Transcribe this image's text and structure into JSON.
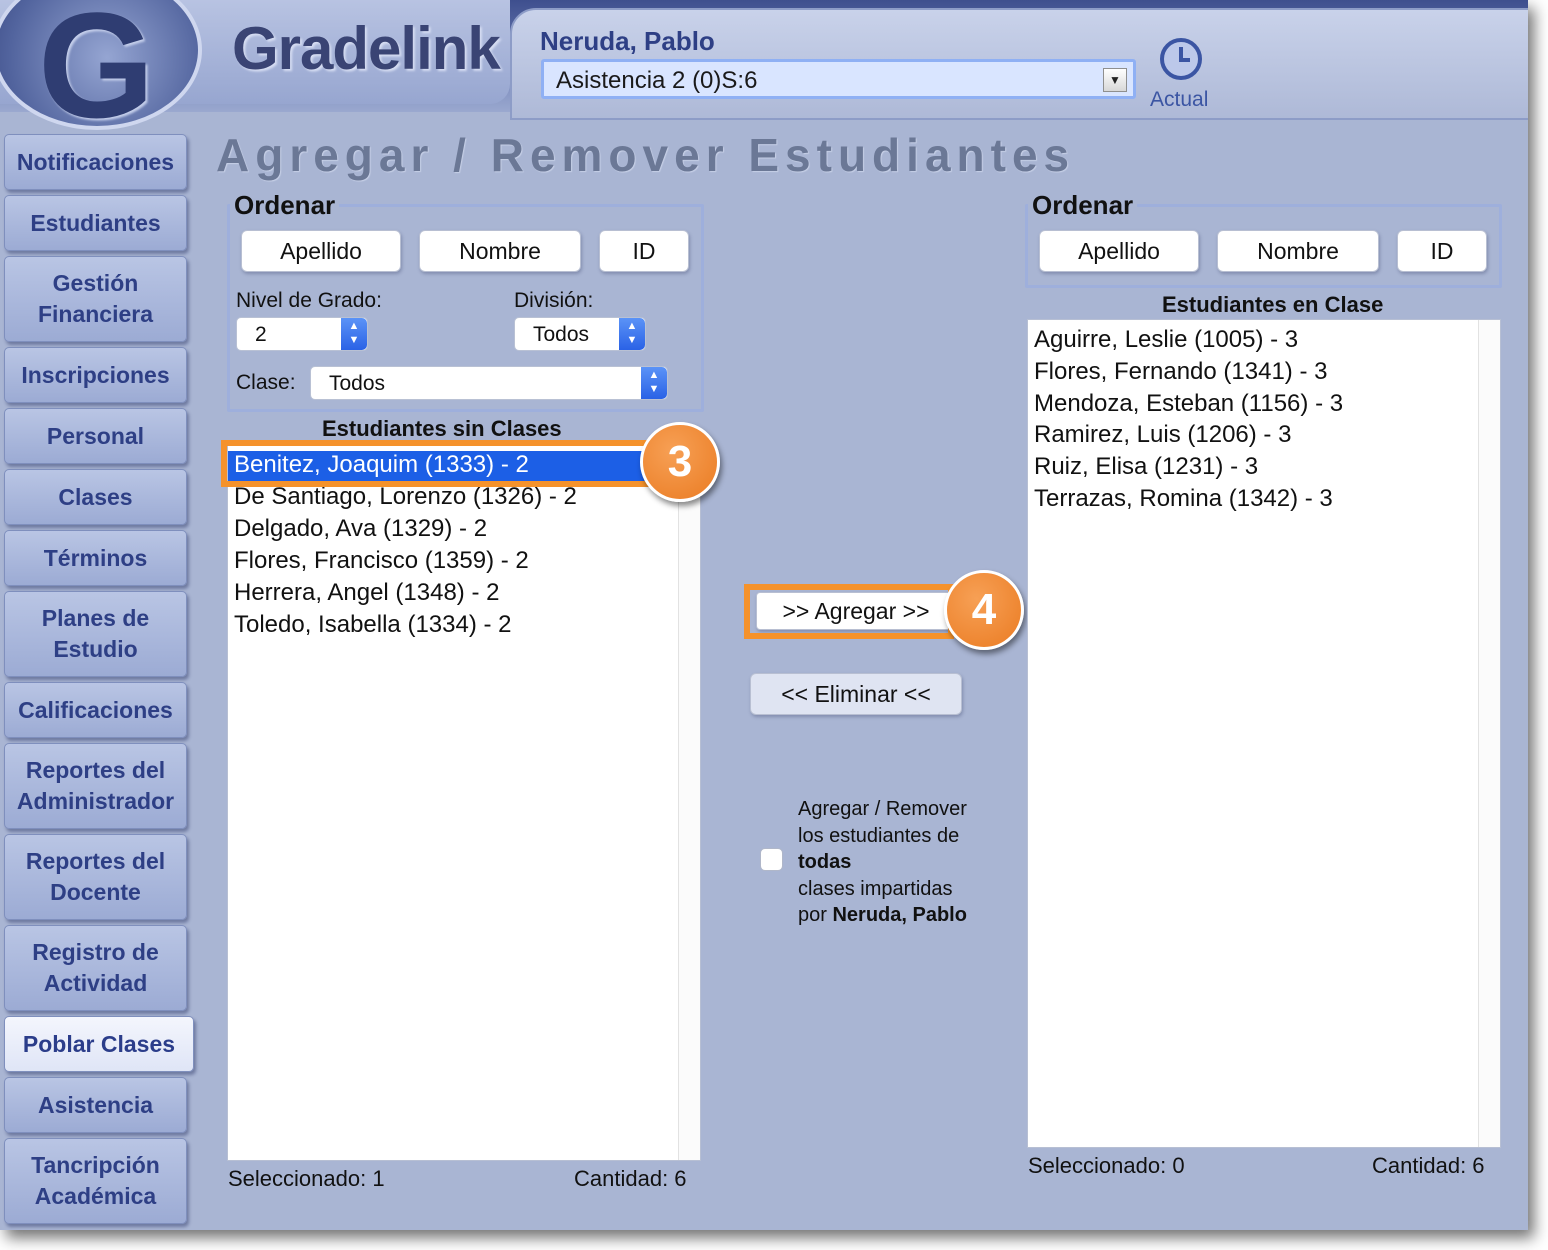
{
  "app": {
    "brand": "Gradelink",
    "logo_letter": "G"
  },
  "header": {
    "teacher_name": "Neruda, Pablo",
    "class_select": {
      "value": "Asistencia 2 (0)S:6"
    },
    "current_button": {
      "label": "Actual",
      "icon": "clock-icon"
    }
  },
  "sidebar": {
    "items": [
      {
        "label": "Notificaciones",
        "active": false
      },
      {
        "label": "Estudiantes",
        "active": false
      },
      {
        "label": "Gestión\nFinanciera",
        "active": false
      },
      {
        "label": "Inscripciones",
        "active": false
      },
      {
        "label": "Personal",
        "active": false
      },
      {
        "label": "Clases",
        "active": false
      },
      {
        "label": "Términos",
        "active": false
      },
      {
        "label": "Planes de\nEstudio",
        "active": false
      },
      {
        "label": "Calificaciones",
        "active": false
      },
      {
        "label": "Reportes del\nAdministrador",
        "active": false
      },
      {
        "label": "Reportes del\nDocente",
        "active": false
      },
      {
        "label": "Registro de\nActividad",
        "active": false
      },
      {
        "label": "Poblar Clases",
        "active": true
      },
      {
        "label": "Asistencia",
        "active": false
      },
      {
        "label": "Tancripción\nAcadémica",
        "active": false
      }
    ]
  },
  "main": {
    "title": "Agregar / Remover Estudiantes",
    "left": {
      "sort": {
        "legend": "Ordenar",
        "buttons": [
          "Apellido",
          "Nombre",
          "ID"
        ]
      },
      "grade_level": {
        "label": "Nivel de Grado:",
        "value": "2"
      },
      "division": {
        "label": "División:",
        "value": "Todos"
      },
      "class_filter": {
        "label": "Clase:",
        "value": "Todos"
      },
      "list_title": "Estudiantes sin Clases",
      "students": [
        "Benitez, Joaquim (1333) - 2",
        "De Santiago, Lorenzo (1326) - 2",
        "Delgado, Ava (1329) - 2",
        "Flores, Francisco (1359) - 2",
        "Herrera, Angel (1348) - 2",
        "Toledo, Isabella (1334) - 2"
      ],
      "selected_index": 0,
      "selected_label": "Seleccionado: 1",
      "count_label": "Cantidad: 6"
    },
    "actions": {
      "add_label": ">> Agregar >>",
      "remove_label": "<< Eliminar <<",
      "all_classes": {
        "checked": false,
        "line1": "Agregar / Remover",
        "line2": "los estudiantes de",
        "line3_bold": "todas",
        "line4": "clases impartidas",
        "line5_prefix": "por",
        "line5_bold": "Neruda, Pablo"
      }
    },
    "right": {
      "sort": {
        "legend": "Ordenar",
        "buttons": [
          "Apellido",
          "Nombre",
          "ID"
        ]
      },
      "list_title": "Estudiantes en Clase",
      "students": [
        "Aguirre, Leslie (1005) - 3",
        "Flores, Fernando (1341) - 3",
        "Mendoza, Esteban (1156) - 3",
        "Ramirez, Luis (1206) - 3",
        "Ruiz, Elisa (1231) - 3",
        "Terrazas, Romina (1342) - 3"
      ],
      "selected_label": "Seleccionado: 0",
      "count_label": "Cantidad: 6"
    }
  },
  "callouts": {
    "step3": "3",
    "step4": "4"
  },
  "colors": {
    "accent_orange": "#f5922b",
    "selection_blue": "#1c5fe6",
    "nav_text": "#2e3f85",
    "background": "#a9b5d3"
  }
}
